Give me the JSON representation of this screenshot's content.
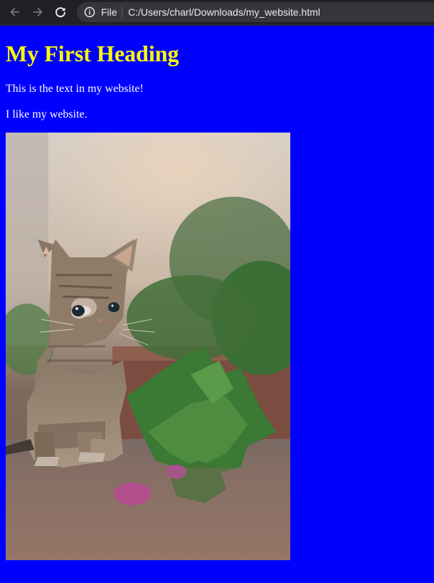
{
  "browser": {
    "scheme_label": "File",
    "url": "C:/Users/charl/Downloads/my_website.html",
    "icons": [
      "back-arrow-icon",
      "forward-arrow-icon",
      "reload-icon",
      "info-icon"
    ]
  },
  "page": {
    "heading": "My First Heading",
    "paragraph_1": "This is the text in my website!",
    "paragraph_2": "I like my website.",
    "image": {
      "subject": "tabby kitten sitting beside a small green juniper plant with pink flowers",
      "alt": ""
    },
    "colors": {
      "background": "#0000ff",
      "heading": "#ffff00",
      "text": "#ffffff"
    }
  }
}
